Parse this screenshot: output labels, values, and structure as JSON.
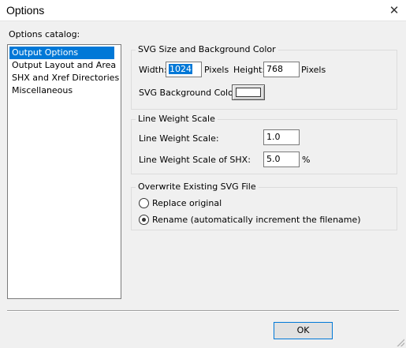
{
  "window": {
    "title": "Options"
  },
  "catalog": {
    "label": "Options catalog:",
    "items": [
      {
        "label": "Output Options",
        "selected": true
      },
      {
        "label": "Output Layout and Area",
        "selected": false
      },
      {
        "label": "SHX and Xref Directories",
        "selected": false
      },
      {
        "label": "Miscellaneous",
        "selected": false
      }
    ]
  },
  "svg_size": {
    "legend": "SVG Size and Background Color",
    "width_label": "Width:",
    "width_value": "1024",
    "width_unit": "Pixels",
    "height_label": "Height:",
    "height_value": "768",
    "height_unit": "Pixels",
    "bg_color_label": "SVG Background Color:",
    "bg_color_value": "#ffffff"
  },
  "line_weight": {
    "legend": "Line Weight Scale",
    "scale_label": "Line Weight Scale:",
    "scale_value": "1.0",
    "shx_label": "Line Weight Scale of SHX:",
    "shx_value": "5.0",
    "shx_unit": "%"
  },
  "overwrite": {
    "legend": "Overwrite Existing SVG File",
    "options": [
      {
        "label": "Replace original",
        "selected": false
      },
      {
        "label": "Rename (automatically increment the filename)",
        "selected": true
      }
    ]
  },
  "buttons": {
    "ok_label": "OK"
  },
  "colors": {
    "selection": "#0078d7",
    "dialog_bg": "#f0f0f0"
  }
}
